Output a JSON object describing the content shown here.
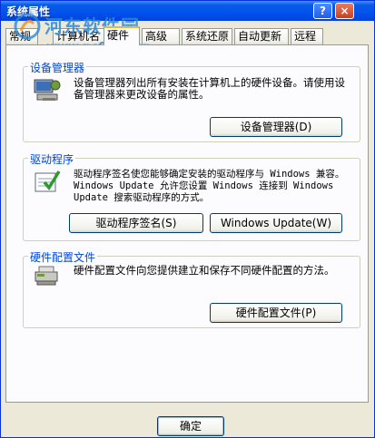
{
  "window": {
    "title": "系统属性",
    "help_label": "?",
    "close_label": "×"
  },
  "watermark": {
    "site_name": "河东软件园",
    "url": "www.pc0359.cn"
  },
  "tabs": [
    {
      "label": "常规"
    },
    {
      "label": "计算机名"
    },
    {
      "label": "硬件"
    },
    {
      "label": "高级"
    },
    {
      "label": "系统还原"
    },
    {
      "label": "自动更新"
    },
    {
      "label": "远程"
    }
  ],
  "device_manager": {
    "title": "设备管理器",
    "description": "设备管理器列出所有安装在计算机上的硬件设备。请使用设备管理器来更改设备的属性。",
    "button_label": "设备管理器(D)",
    "icon": "device-manager-icon"
  },
  "drivers": {
    "title": "驱动程序",
    "description": "驱动程序签名使您能够确定安装的驱动程序与 Windows 兼容。Windows Update 允许您设置 Windows 连接到 Windows Update 搜索驱动程序的方式。",
    "signing_button_label": "驱动程序签名(S)",
    "update_button_label": "Windows Update(W)",
    "icon": "driver-signing-icon"
  },
  "hardware_profiles": {
    "title": "硬件配置文件",
    "description": "硬件配置文件向您提供建立和保存不同硬件配置的方法。",
    "button_label": "硬件配置文件(P)",
    "icon": "hardware-profile-icon"
  },
  "footer": {
    "ok_label": "确定"
  },
  "colors": {
    "titlebar": "#0053ee",
    "group_title": "#0046d5",
    "active_tab_accent": "#f6b33a"
  }
}
